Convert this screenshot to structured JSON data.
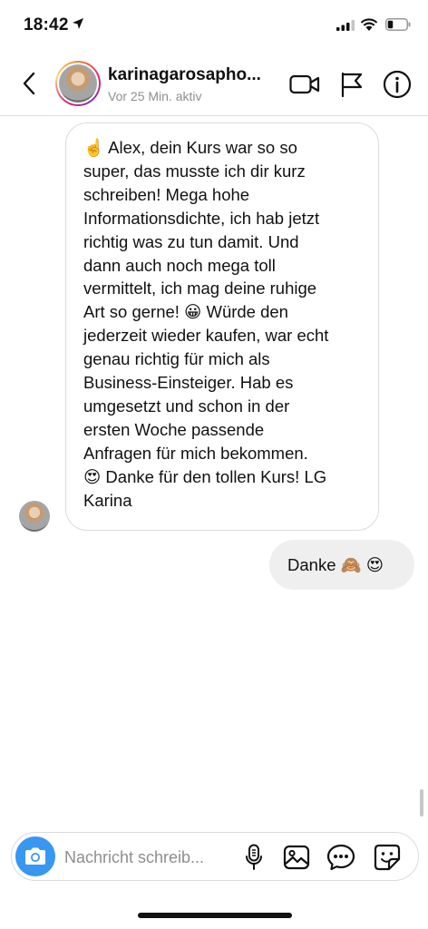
{
  "status_bar": {
    "time": "18:42"
  },
  "header": {
    "username": "karinagarosapho...",
    "activity": "Vor 25 Min. aktiv",
    "icons": [
      "back-icon",
      "video-camera-icon",
      "flag-icon",
      "info-icon"
    ]
  },
  "conversation": {
    "incoming": {
      "lines": [
        "☝️  Alex, dein Kurs war so so",
        "super, das musste ich dir kurz",
        "schreiben! Mega hohe",
        "Informationsdichte, ich hab jetzt",
        "richtig was zu tun damit. Und",
        "dann auch noch mega toll",
        "vermittelt, ich mag deine ruhige",
        "Art so gerne! 😀  Würde den",
        "jederzeit wieder kaufen, war echt",
        "genau richtig für mich als",
        "Business-Einsteiger. Hab es",
        "umgesetzt und schon in der",
        "ersten Woche passende",
        "Anfragen für mich bekommen.",
        "😍  Danke für den tollen Kurs! LG",
        "Karina"
      ]
    },
    "outgoing": {
      "text": "Danke 🙈 😍"
    }
  },
  "composer": {
    "placeholder": "Nachricht schreib...",
    "icons": [
      "camera-icon",
      "microphone-icon",
      "gallery-icon",
      "more-options-icon",
      "sticker-icon"
    ]
  },
  "colors": {
    "accent": "#3897f0",
    "outgoing_bubble": "#efefef",
    "border": "#dbdbdb",
    "secondary_text": "#8e8e8e"
  }
}
